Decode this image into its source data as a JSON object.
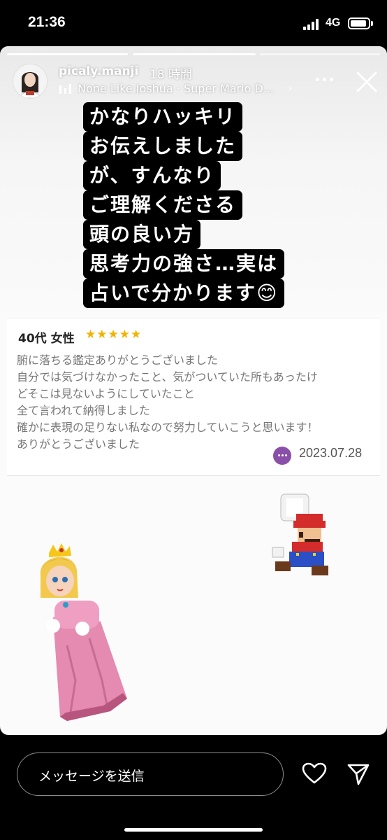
{
  "status_bar": {
    "time": "21:36",
    "network": "4G"
  },
  "story": {
    "username": "picaly.manji",
    "posted_ago": "18 時間",
    "music": "None Like Joshua · Super Mario D...",
    "caption_lines": [
      "かなりハッキリ",
      "お伝えしました",
      "が、すんなり",
      "ご理解くださる",
      "頭の良い方",
      "思考力の強さ…実は",
      "占いで分かります😊"
    ],
    "review": {
      "age_gender": "40代 女性",
      "stars": "★★★★★",
      "rating": 5,
      "lines": [
        "腑に落ちる鑑定ありがとうございました",
        "自分では気づけなかったこと、気がついていた所もあったけ",
        "どそこは見ないようにしていたこと",
        "全て言われて納得しました",
        "確かに表現の足りない私なので努力していこうと思います！",
        "ありがとうございました"
      ],
      "date": "2023.07.28"
    }
  },
  "reply_bar": {
    "placeholder": "メッセージを送信"
  },
  "icons": {
    "signal": "signal-bars-icon",
    "battery": "battery-icon",
    "music": "music-bars-icon",
    "more": "more-dots-icon",
    "close": "close-icon",
    "chat": "chat-bubble-icon",
    "heart": "heart-icon",
    "send": "send-icon"
  },
  "colors": {
    "star": "#f0b400",
    "chat_icon": "#8a4fa8"
  }
}
